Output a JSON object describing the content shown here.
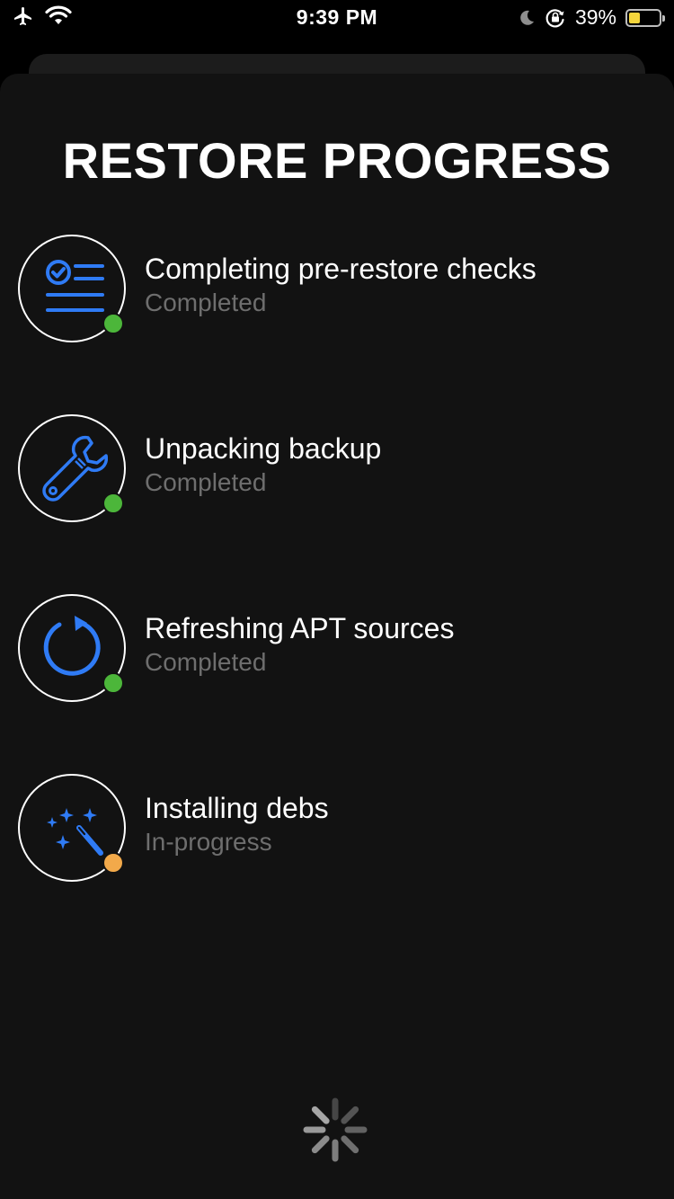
{
  "status_bar": {
    "time": "9:39 PM",
    "battery_percent": "39%",
    "battery_level": 0.39,
    "icons": [
      "airplane-icon",
      "wifi-icon",
      "moon-icon",
      "rotation-lock-icon",
      "battery-icon"
    ]
  },
  "title": "RESTORE PROGRESS",
  "steps": [
    {
      "title": "Completing pre-restore checks",
      "status": "Completed",
      "icon": "checklist-icon",
      "state": "completed"
    },
    {
      "title": "Unpacking backup",
      "status": "Completed",
      "icon": "wrench-icon",
      "state": "completed"
    },
    {
      "title": "Refreshing APT sources",
      "status": "Completed",
      "icon": "refresh-icon",
      "state": "completed"
    },
    {
      "title": "Installing debs",
      "status": "In-progress",
      "icon": "magic-wand-icon",
      "state": "in-progress"
    }
  ],
  "colors": {
    "background": "#000000",
    "sheet": "#121212",
    "accent_blue": "#2f7bf5",
    "completed_green": "#4cb63a",
    "in_progress_orange": "#f2a94a",
    "battery_yellow": "#f5d63c"
  },
  "loading_indicator": "spinner-icon"
}
